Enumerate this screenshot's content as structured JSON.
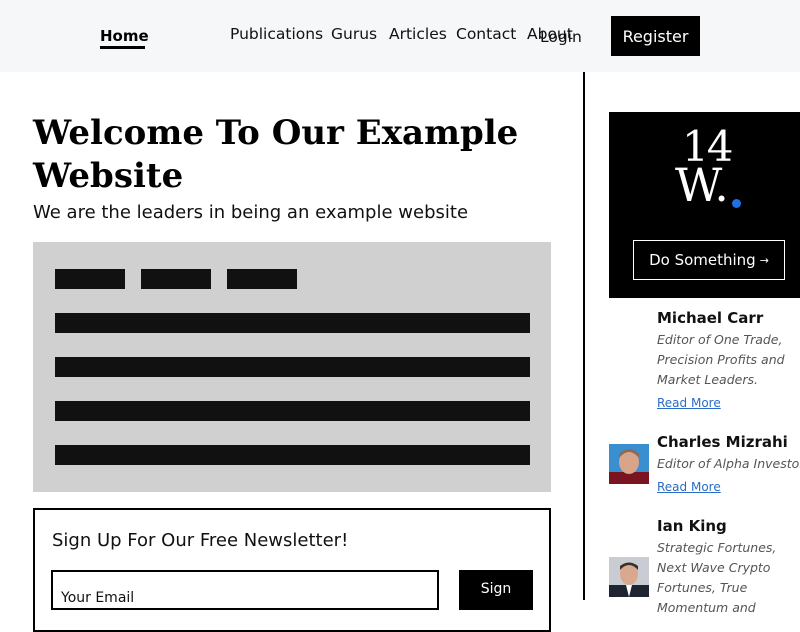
{
  "nav": {
    "home": "Home",
    "links": [
      "Publications",
      "Gurus",
      "Articles",
      "Contact",
      "About"
    ],
    "login": "Login",
    "register": "Register"
  },
  "main": {
    "title": "Welcome To Our Example Website",
    "subtitle": "We are the leaders in being an example website"
  },
  "newsletter": {
    "title": "Sign Up For Our Free Newsletter!",
    "email_placeholder": "Your Email",
    "button": "Sign"
  },
  "sidebar": {
    "logo_number": "14",
    "logo_letter": "W.",
    "cta": "Do Something",
    "cta_arrow": "→",
    "gurus": [
      {
        "name": "Michael Carr",
        "desc": "Editor of One Trade, Precision Profits and Market Leaders.",
        "link": "Read More"
      },
      {
        "name": "Charles Mizrahi",
        "desc": "Editor of Alpha Investor",
        "link": "Read More"
      },
      {
        "name": "Ian King",
        "desc": "Strategic Fortunes, Next Wave Crypto Fortunes, True Momentum and"
      }
    ]
  },
  "colors": {
    "accent_blue": "#1f6fe5",
    "link_blue": "#2b6cc4",
    "placeholder_gray": "#d0d0d0",
    "header_bg": "#f6f7f9"
  }
}
